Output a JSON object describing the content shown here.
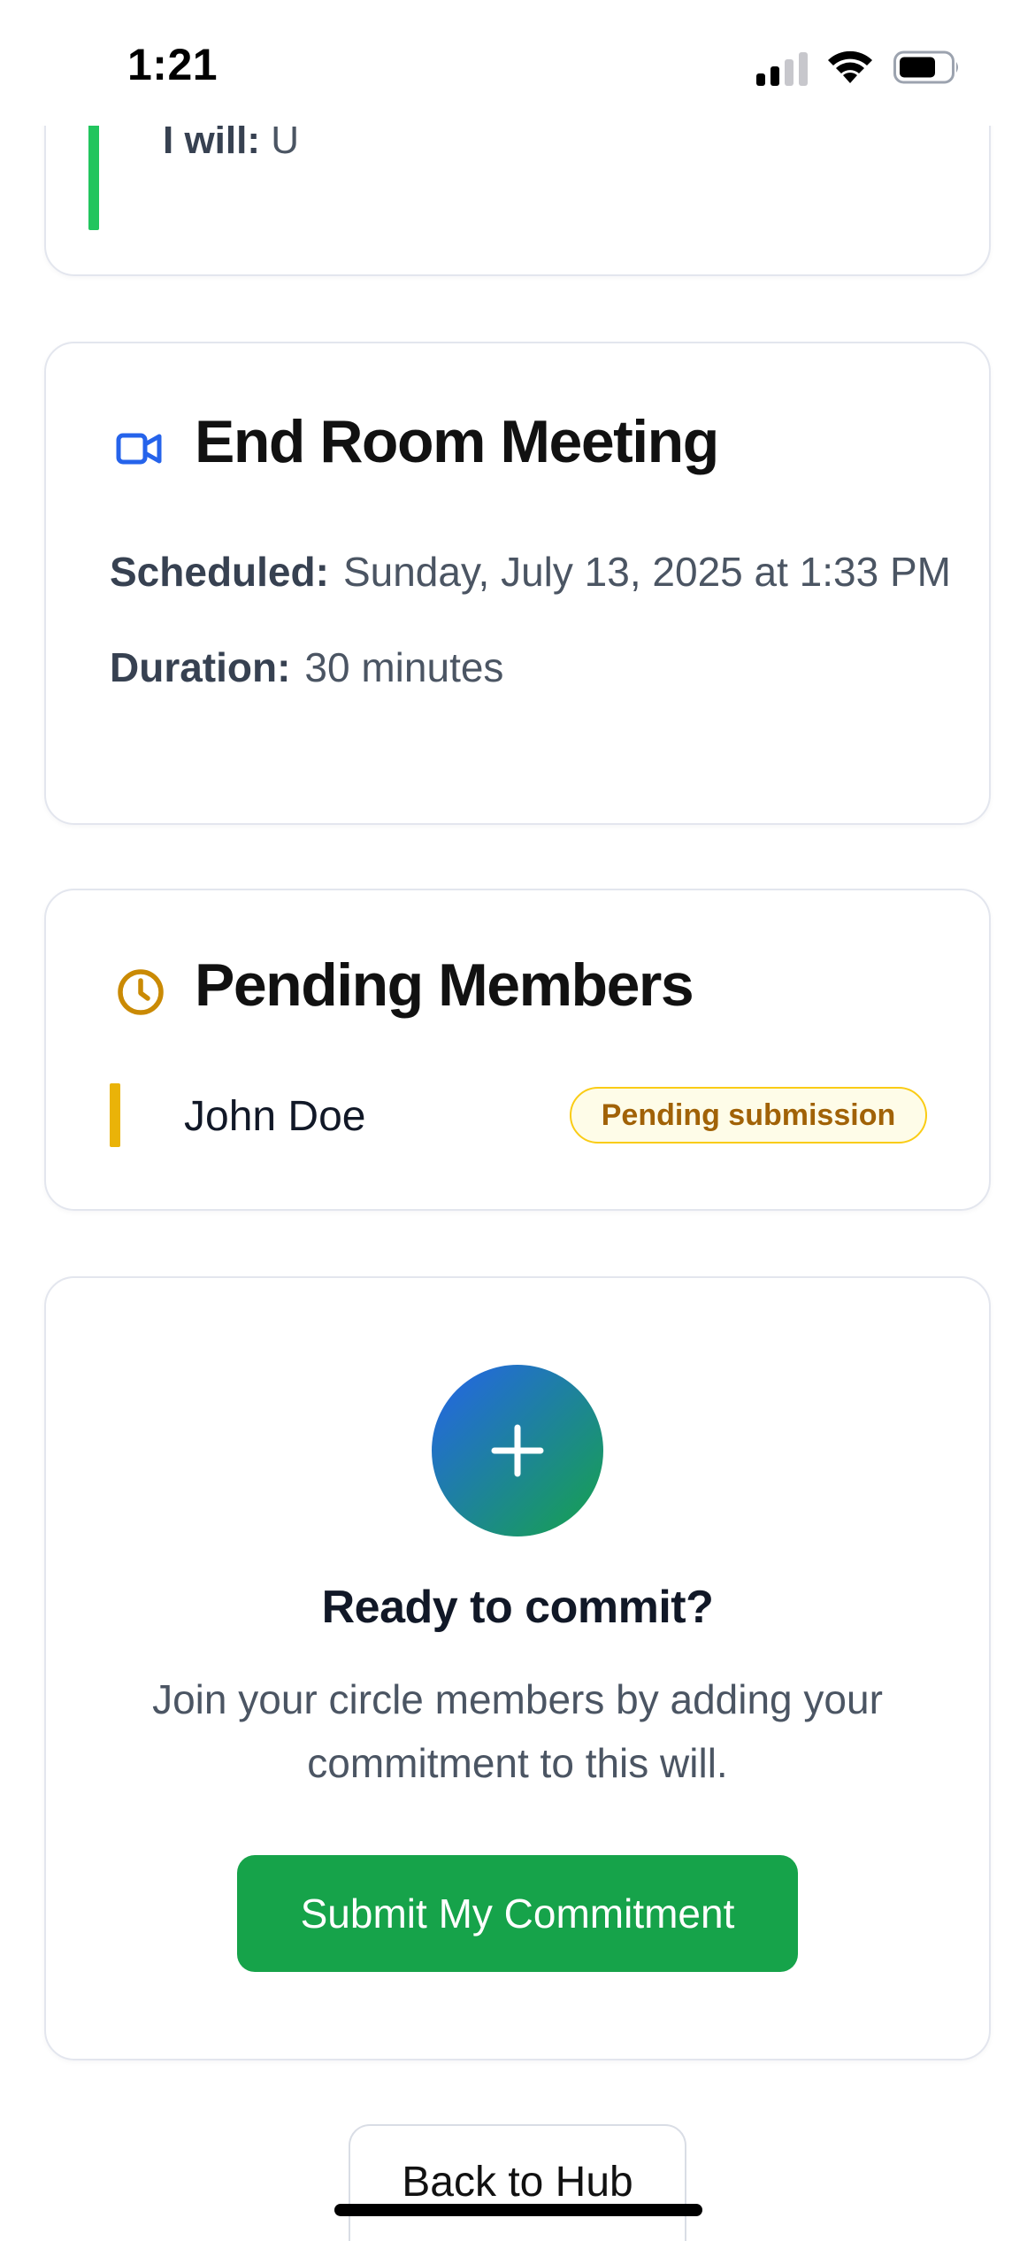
{
  "status_bar": {
    "time": "1:21"
  },
  "will": {
    "label": "I will:",
    "value": "U",
    "accent_color": "#22c55e"
  },
  "meeting": {
    "icon": "video-camera-icon",
    "title": "End Room Meeting",
    "scheduled_label": "Scheduled:",
    "scheduled_value": "Sunday, July 13, 2025 at 1:33 PM",
    "duration_label": "Duration:",
    "duration_value": "30 minutes"
  },
  "pending": {
    "icon": "clock-icon",
    "title": "Pending Members",
    "members": [
      {
        "name": "John Doe",
        "status": "Pending submission"
      }
    ],
    "accent_color": "#eab308"
  },
  "commit": {
    "icon": "plus-icon",
    "heading": "Ready to commit?",
    "description": "Join your circle members by adding your commitment to this will.",
    "submit_label": "Submit My Commitment",
    "button_color": "#16a34a"
  },
  "footer": {
    "back_label": "Back to Hub"
  }
}
